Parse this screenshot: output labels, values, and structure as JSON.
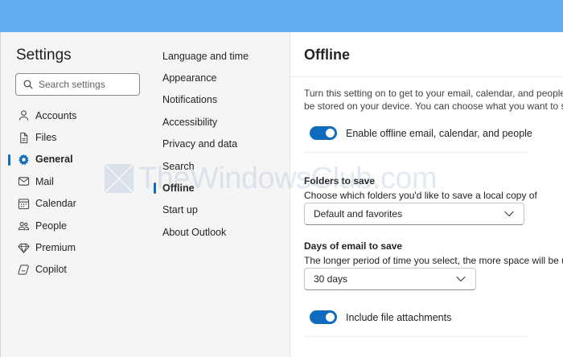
{
  "sidebar": {
    "title": "Settings",
    "search_placeholder": "Search settings",
    "items": [
      {
        "label": "Accounts",
        "icon": "person-icon"
      },
      {
        "label": "Files",
        "icon": "file-icon"
      },
      {
        "label": "General",
        "icon": "gear-icon",
        "active": true
      },
      {
        "label": "Mail",
        "icon": "mail-icon"
      },
      {
        "label": "Calendar",
        "icon": "calendar-icon"
      },
      {
        "label": "People",
        "icon": "people-icon"
      },
      {
        "label": "Premium",
        "icon": "diamond-icon"
      },
      {
        "label": "Copilot",
        "icon": "copilot-icon"
      }
    ]
  },
  "subnav": {
    "items": [
      {
        "label": "Language and time"
      },
      {
        "label": "Appearance"
      },
      {
        "label": "Notifications"
      },
      {
        "label": "Accessibility"
      },
      {
        "label": "Privacy and data"
      },
      {
        "label": "Search"
      },
      {
        "label": "Offline",
        "active": true
      },
      {
        "label": "Start up"
      },
      {
        "label": "About Outlook"
      }
    ]
  },
  "main": {
    "title": "Offline",
    "description_line1": "Turn this setting on to get to your email, calendar, and people",
    "description_line2": "be stored on your device. You can choose what you want to s",
    "enable_toggle": {
      "label": "Enable offline email, calendar, and people",
      "on": true
    },
    "folders": {
      "label": "Folders to save",
      "desc": "Choose which folders you'd like to save a local copy of",
      "selected": "Default and favorites"
    },
    "days": {
      "label": "Days of email to save",
      "desc": "The longer period of time you select, the more space will be u",
      "selected": "30 days"
    },
    "attachments_toggle": {
      "label": "Include file attachments",
      "on": true
    }
  },
  "watermark": {
    "text": "TheWindowsClub.com"
  },
  "colors": {
    "accent": "#0f6cbd",
    "topbar": "#63acf2",
    "panel_bg": "#f5f5f5"
  }
}
